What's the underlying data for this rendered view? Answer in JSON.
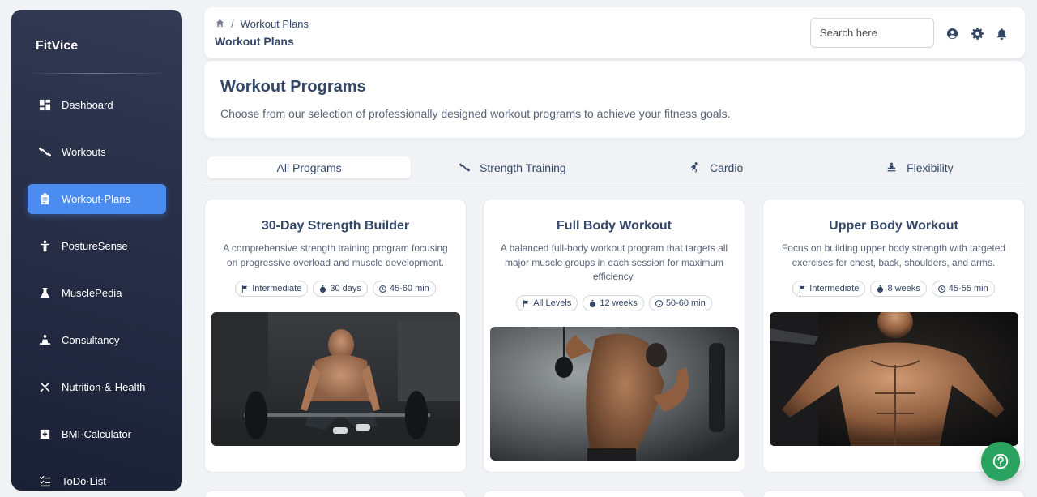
{
  "sidebar": {
    "brand": "FitVice",
    "items": [
      {
        "label": "Dashboard",
        "icon": "dashboard-icon"
      },
      {
        "label": "Workouts",
        "icon": "dumbbell-icon"
      },
      {
        "label": "Workout·Plans",
        "icon": "clipboard-icon"
      },
      {
        "label": "PostureSense",
        "icon": "accessibility-icon"
      },
      {
        "label": "MusclePedia",
        "icon": "flask-icon"
      },
      {
        "label": "Consultancy",
        "icon": "person-desk-icon"
      },
      {
        "label": "Nutrition·&·Health",
        "icon": "utensils-icon"
      },
      {
        "label": "BMI·Calculator",
        "icon": "calculator-icon"
      },
      {
        "label": "ToDo·List",
        "icon": "checklist-icon"
      }
    ],
    "active_index": 2
  },
  "topbar": {
    "breadcrumb_current": "Workout Plans",
    "breadcrumb_separator": "/",
    "title": "Workout Plans",
    "search_placeholder": "Search here"
  },
  "header": {
    "title": "Workout Programs",
    "subtitle": "Choose from our selection of professionally designed workout programs to achieve your fitness goals."
  },
  "tabs": [
    {
      "label": "All Programs",
      "icon": ""
    },
    {
      "label": "Strength Training",
      "icon": "dumbbell-icon"
    },
    {
      "label": "Cardio",
      "icon": "running-icon"
    },
    {
      "label": "Flexibility",
      "icon": "meditation-icon"
    }
  ],
  "programs": [
    {
      "title": "30-Day Strength Builder",
      "description": "A comprehensive strength training program focusing on progressive overload and muscle development.",
      "level": "Intermediate",
      "duration": "30 days",
      "session": "45-60 min"
    },
    {
      "title": "Full Body Workout",
      "description": "A balanced full-body workout program that targets all major muscle groups in each session for maximum efficiency.",
      "level": "All Levels",
      "duration": "12 weeks",
      "session": "50-60 min"
    },
    {
      "title": "Upper Body Workout",
      "description": "Focus on building upper body strength with targeted exercises for chest, back, shoulders, and arms.",
      "level": "Intermediate",
      "duration": "8 weeks",
      "session": "45-55 min"
    }
  ],
  "colors": {
    "sidebar_bg": "#1f2638",
    "active_nav": "#4a8cf0",
    "help_button": "#29a35f",
    "text_primary": "#344767"
  }
}
